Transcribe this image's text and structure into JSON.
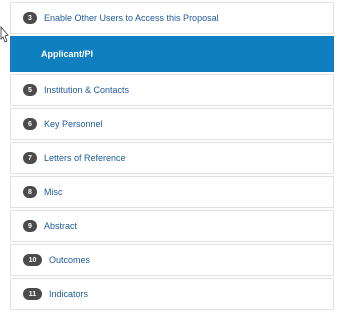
{
  "nav": {
    "items": [
      {
        "number": "3",
        "label": "Enable Other Users to Access this Proposal",
        "active": false
      },
      {
        "number": "",
        "label": "Applicant/PI",
        "active": true
      },
      {
        "number": "5",
        "label": "Institution & Contacts",
        "active": false
      },
      {
        "number": "6",
        "label": "Key Personnel",
        "active": false
      },
      {
        "number": "7",
        "label": "Letters of Reference",
        "active": false
      },
      {
        "number": "8",
        "label": "Misc",
        "active": false
      },
      {
        "number": "9",
        "label": "Abstract",
        "active": false
      },
      {
        "number": "10",
        "label": "Outcomes",
        "active": false
      },
      {
        "number": "11",
        "label": "Indicators",
        "active": false
      }
    ]
  },
  "colors": {
    "active_bg": "#0f7fc0",
    "label_color": "#1f5a9a",
    "badge_bg": "#4b4b4b"
  }
}
